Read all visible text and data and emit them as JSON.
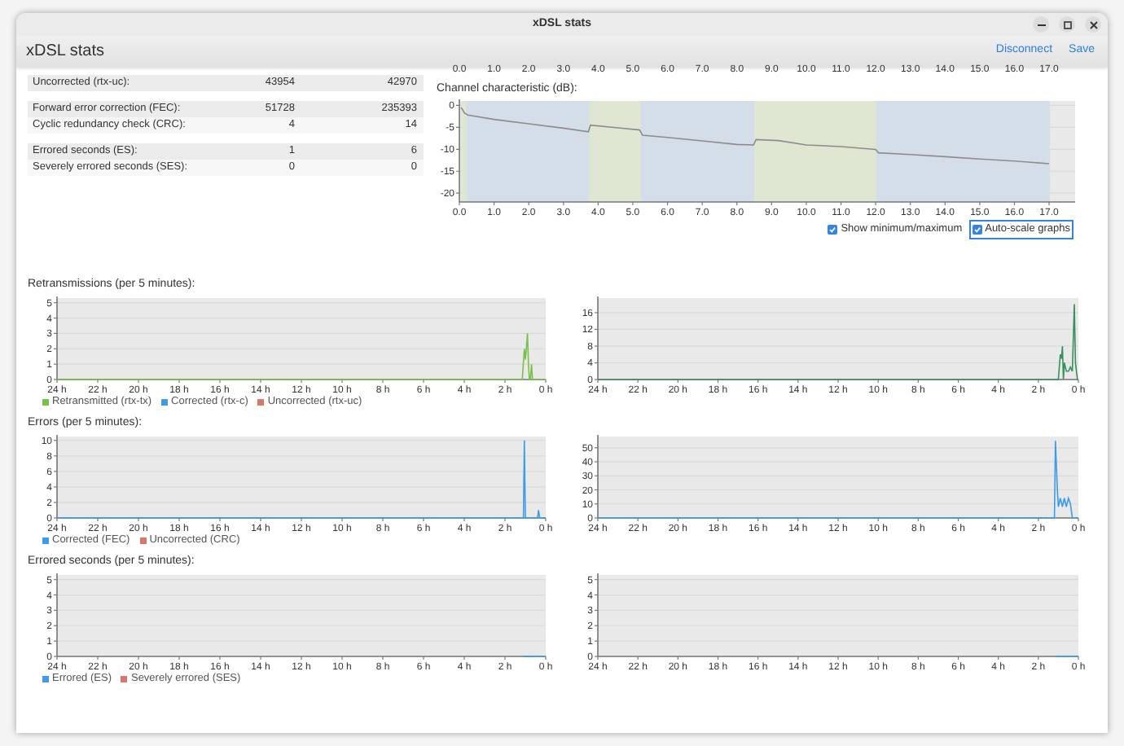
{
  "window": {
    "title": "xDSL stats"
  },
  "header": {
    "title": "xDSL stats",
    "actions": [
      "Disconnect",
      "Save"
    ]
  },
  "stats_table": {
    "groups": [
      [
        {
          "label": "Uncorrected (rtx-uc):",
          "values": [
            "43954",
            "42970"
          ]
        }
      ],
      [
        {
          "label": "Forward error correction (FEC):",
          "values": [
            "51728",
            "235393"
          ]
        },
        {
          "label": "Cyclic redundancy check (CRC):",
          "values": [
            "4",
            "14"
          ]
        }
      ],
      [
        {
          "label": "Errored seconds (ES):",
          "values": [
            "1",
            "6"
          ]
        },
        {
          "label": "Severely errored seconds (SES):",
          "values": [
            "0",
            "0"
          ]
        }
      ]
    ]
  },
  "previous_chart_axis": {
    "labels": [
      "0.0",
      "1.0",
      "2.0",
      "3.0",
      "4.0",
      "5.0",
      "6.0",
      "7.0",
      "8.0",
      "9.0",
      "10.0",
      "11.0",
      "12.0",
      "13.0",
      "14.0",
      "15.0",
      "16.0",
      "17.0"
    ]
  },
  "channel_characteristic": {
    "title": "Channel characteristic (dB):",
    "chart_data": {
      "type": "line",
      "xlim": [
        0,
        17.75
      ],
      "ylim": [
        -22,
        1
      ],
      "x": [
        0.05,
        0.15,
        0.25,
        1,
        2,
        3,
        3.72,
        3.78,
        5.2,
        5.28,
        6,
        7,
        8,
        8.48,
        8.55,
        9.2,
        10,
        11,
        12,
        12.08,
        13,
        14,
        15,
        16,
        17
      ],
      "series": [
        {
          "color": "#8c8c8c",
          "values": [
            -0.5,
            -1.8,
            -2.2,
            -3.2,
            -4.2,
            -5.2,
            -6,
            -4.5,
            -5.6,
            -6.8,
            -7.3,
            -8.1,
            -8.9,
            -9,
            -7.8,
            -8,
            -9,
            -9.4,
            -10,
            -10.8,
            -11.2,
            -11.7,
            -12.2,
            -12.7,
            -13.3
          ]
        }
      ],
      "xticks": [
        {
          "value": 0,
          "label": "0.0"
        },
        {
          "value": 1,
          "label": "1.0"
        },
        {
          "value": 2,
          "label": "2.0"
        },
        {
          "value": 3,
          "label": "3.0"
        },
        {
          "value": 4,
          "label": "4.0"
        },
        {
          "value": 5,
          "label": "5.0"
        },
        {
          "value": 6,
          "label": "6.0"
        },
        {
          "value": 7,
          "label": "7.0"
        },
        {
          "value": 8,
          "label": "8.0"
        },
        {
          "value": 9,
          "label": "9.0"
        },
        {
          "value": 10,
          "label": "10.0"
        },
        {
          "value": 11,
          "label": "11.0"
        },
        {
          "value": 12,
          "label": "12.0"
        },
        {
          "value": 13,
          "label": "13.0"
        },
        {
          "value": 14,
          "label": "14.0"
        },
        {
          "value": 15,
          "label": "15.0"
        },
        {
          "value": 16,
          "label": "16.0"
        },
        {
          "value": 17,
          "label": "17.0"
        }
      ],
      "yticks": [
        0,
        -5,
        -10,
        -15,
        -20
      ],
      "grid": true,
      "bands": [
        {
          "axis": "x",
          "from": 0.05,
          "to": 0.2,
          "color": "#dfe6d2"
        },
        {
          "axis": "x",
          "from": 0.2,
          "to": 3.75,
          "color": "#d4dee9"
        },
        {
          "axis": "x",
          "from": 3.75,
          "to": 5.22,
          "color": "#dfe6d2"
        },
        {
          "axis": "x",
          "from": 5.22,
          "to": 8.5,
          "color": "#d4dee9"
        },
        {
          "axis": "x",
          "from": 8.5,
          "to": 12.02,
          "color": "#dfe6d2"
        },
        {
          "axis": "x",
          "from": 12.02,
          "to": 17.02,
          "color": "#d4dee9"
        }
      ]
    }
  },
  "options": [
    {
      "label": "Show minimum/maximum",
      "checked": true,
      "focused": false
    },
    {
      "label": "Auto-scale graphs",
      "checked": true,
      "focused": true
    }
  ],
  "sections": [
    {
      "title": "Retransmissions (per 5 minutes):",
      "charts": [
        {
          "chart_data": {
            "type": "line",
            "xlim": [
              24,
              0
            ],
            "ylim": [
              0,
              5.3
            ],
            "yticks": [
              0,
              1,
              2,
              3,
              4,
              5
            ],
            "xticks": [
              {
                "value": 24,
                "label": "24 h"
              },
              {
                "value": 22,
                "label": "22 h"
              },
              {
                "value": 20,
                "label": "20 h"
              },
              {
                "value": 18,
                "label": "18 h"
              },
              {
                "value": 16,
                "label": "16 h"
              },
              {
                "value": 14,
                "label": "14 h"
              },
              {
                "value": 12,
                "label": "12 h"
              },
              {
                "value": 10,
                "label": "10 h"
              },
              {
                "value": 8,
                "label": "8 h"
              },
              {
                "value": 6,
                "label": "6 h"
              },
              {
                "value": 4,
                "label": "4 h"
              },
              {
                "value": 2,
                "label": "2 h"
              },
              {
                "value": 0,
                "label": "0 h"
              }
            ],
            "x": [
              24,
              1.15,
              1.05,
              1.0,
              0.95,
              0.9,
              0.85,
              0.8,
              0.75,
              0.7,
              0.65,
              0.6,
              0
            ],
            "series": [
              {
                "name": "Retransmitted (rtx-tx)",
                "color": "#77c14a",
                "values": [
                  0,
                  0,
                  2,
                  1.3,
                  2,
                  3,
                  1,
                  0,
                  0,
                  1,
                  0,
                  0,
                  0
                ]
              },
              {
                "name": "Corrected (rtx-c)",
                "color": "#3d9be9",
                "values": [
                  null,
                  null,
                  null,
                  null,
                  null,
                  null,
                  null,
                  null,
                  null,
                  null,
                  null,
                  null,
                  null
                ]
              },
              {
                "name": "Uncorrected (rtx-uc)",
                "color": "#d9776c",
                "values": [
                  null,
                  null,
                  null,
                  null,
                  null,
                  null,
                  null,
                  null,
                  null,
                  null,
                  null,
                  null,
                  null
                ]
              }
            ],
            "grid": true
          }
        },
        {
          "chart_data": {
            "type": "line",
            "xlim": [
              24,
              0
            ],
            "ylim": [
              0,
              19.5
            ],
            "yticks": [
              0,
              4,
              8,
              12,
              16
            ],
            "xticks": [
              {
                "value": 24,
                "label": "24 h"
              },
              {
                "value": 22,
                "label": "22 h"
              },
              {
                "value": 20,
                "label": "20 h"
              },
              {
                "value": 18,
                "label": "18 h"
              },
              {
                "value": 16,
                "label": "16 h"
              },
              {
                "value": 14,
                "label": "14 h"
              },
              {
                "value": 12,
                "label": "12 h"
              },
              {
                "value": 10,
                "label": "10 h"
              },
              {
                "value": 8,
                "label": "8 h"
              },
              {
                "value": 6,
                "label": "6 h"
              },
              {
                "value": 4,
                "label": "4 h"
              },
              {
                "value": 2,
                "label": "2 h"
              },
              {
                "value": 0,
                "label": "0 h"
              }
            ],
            "x": [
              24,
              1.0,
              0.9,
              0.85,
              0.8,
              0.75,
              0.7,
              0.6,
              0.5,
              0.4,
              0.3,
              0.2,
              0.15,
              0.1,
              0.05,
              0
            ],
            "series": [
              {
                "color": "#3a8f5c",
                "values": [
                  0,
                  0,
                  6,
                  5,
                  8,
                  0,
                  4,
                  2,
                  2,
                  3,
                  2,
                  18,
                  4,
                  2,
                  0,
                  0
                ]
              }
            ],
            "grid": true
          }
        }
      ]
    },
    {
      "title": "Errors (per 5 minutes):",
      "charts": [
        {
          "chart_data": {
            "type": "line",
            "xlim": [
              24,
              0
            ],
            "ylim": [
              0,
              10.5
            ],
            "yticks": [
              0,
              2,
              4,
              6,
              8,
              10
            ],
            "xticks": [
              {
                "value": 24,
                "label": "24 h"
              },
              {
                "value": 22,
                "label": "22 h"
              },
              {
                "value": 20,
                "label": "20 h"
              },
              {
                "value": 18,
                "label": "18 h"
              },
              {
                "value": 16,
                "label": "16 h"
              },
              {
                "value": 14,
                "label": "14 h"
              },
              {
                "value": 12,
                "label": "12 h"
              },
              {
                "value": 10,
                "label": "10 h"
              },
              {
                "value": 8,
                "label": "8 h"
              },
              {
                "value": 6,
                "label": "6 h"
              },
              {
                "value": 4,
                "label": "4 h"
              },
              {
                "value": 2,
                "label": "2 h"
              },
              {
                "value": 0,
                "label": "0 h"
              }
            ],
            "x": [
              24,
              1.1,
              1.05,
              1.0,
              0.5,
              0.4,
              0.35,
              0.3,
              0
            ],
            "series": [
              {
                "name": "Corrected (FEC)",
                "color": "#3d9be9",
                "values": [
                  0,
                  0,
                  10,
                  0,
                  0,
                  0,
                  1,
                  0,
                  0
                ]
              },
              {
                "name": "Uncorrected (CRC)",
                "color": "#d9776c",
                "values": [
                  null,
                  null,
                  null,
                  null,
                  null,
                  null,
                  null,
                  null,
                  null
                ]
              }
            ],
            "grid": true
          }
        },
        {
          "chart_data": {
            "type": "line",
            "xlim": [
              24,
              0
            ],
            "ylim": [
              0,
              58
            ],
            "yticks": [
              0,
              10,
              20,
              30,
              40,
              50
            ],
            "xticks": [
              {
                "value": 24,
                "label": "24 h"
              },
              {
                "value": 22,
                "label": "22 h"
              },
              {
                "value": 20,
                "label": "20 h"
              },
              {
                "value": 18,
                "label": "18 h"
              },
              {
                "value": 16,
                "label": "16 h"
              },
              {
                "value": 14,
                "label": "14 h"
              },
              {
                "value": 12,
                "label": "12 h"
              },
              {
                "value": 10,
                "label": "10 h"
              },
              {
                "value": 8,
                "label": "8 h"
              },
              {
                "value": 6,
                "label": "6 h"
              },
              {
                "value": 4,
                "label": "4 h"
              },
              {
                "value": 2,
                "label": "2 h"
              },
              {
                "value": 0,
                "label": "0 h"
              }
            ],
            "x": [
              24,
              1.2,
              1.15,
              1.05,
              1.0,
              0.9,
              0.8,
              0.7,
              0.6,
              0.5,
              0.4,
              0.3,
              0
            ],
            "series": [
              {
                "color": "#3d9be9",
                "values": [
                  0,
                  0,
                  55,
                  20,
                  8,
                  14,
                  8,
                  14,
                  8,
                  14,
                  10,
                  0,
                  0
                ]
              }
            ],
            "grid": true
          }
        }
      ]
    },
    {
      "title": "Errored seconds (per 5 minutes):",
      "charts": [
        {
          "chart_data": {
            "type": "line",
            "xlim": [
              24,
              0
            ],
            "ylim": [
              0,
              5.3
            ],
            "yticks": [
              0,
              1,
              2,
              3,
              4,
              5
            ],
            "xticks": [
              {
                "value": 24,
                "label": "24 h"
              },
              {
                "value": 22,
                "label": "22 h"
              },
              {
                "value": 20,
                "label": "20 h"
              },
              {
                "value": 18,
                "label": "18 h"
              },
              {
                "value": 16,
                "label": "16 h"
              },
              {
                "value": 14,
                "label": "14 h"
              },
              {
                "value": 12,
                "label": "12 h"
              },
              {
                "value": 10,
                "label": "10 h"
              },
              {
                "value": 8,
                "label": "8 h"
              },
              {
                "value": 6,
                "label": "6 h"
              },
              {
                "value": 4,
                "label": "4 h"
              },
              {
                "value": 2,
                "label": "2 h"
              },
              {
                "value": 0,
                "label": "0 h"
              }
            ],
            "x": [
              1.1,
              0
            ],
            "series": [
              {
                "name": "Errored (ES)",
                "color": "#3d9be9",
                "values": [
                  0,
                  0
                ]
              },
              {
                "name": "Severely errored (SES)",
                "color": "#d9776c",
                "values": [
                  null,
                  null
                ]
              }
            ],
            "grid": true
          }
        },
        {
          "chart_data": {
            "type": "line",
            "xlim": [
              24,
              0
            ],
            "ylim": [
              0,
              5.3
            ],
            "yticks": [
              0,
              1,
              2,
              3,
              4,
              5
            ],
            "xticks": [
              {
                "value": 24,
                "label": "24 h"
              },
              {
                "value": 22,
                "label": "22 h"
              },
              {
                "value": 20,
                "label": "20 h"
              },
              {
                "value": 18,
                "label": "18 h"
              },
              {
                "value": 16,
                "label": "16 h"
              },
              {
                "value": 14,
                "label": "14 h"
              },
              {
                "value": 12,
                "label": "12 h"
              },
              {
                "value": 10,
                "label": "10 h"
              },
              {
                "value": 8,
                "label": "8 h"
              },
              {
                "value": 6,
                "label": "6 h"
              },
              {
                "value": 4,
                "label": "4 h"
              },
              {
                "value": 2,
                "label": "2 h"
              },
              {
                "value": 0,
                "label": "0 h"
              }
            ],
            "x": [
              1.1,
              0
            ],
            "series": [
              {
                "color": "#3d9be9",
                "values": [
                  0,
                  0
                ]
              }
            ],
            "grid": true
          }
        }
      ]
    }
  ]
}
